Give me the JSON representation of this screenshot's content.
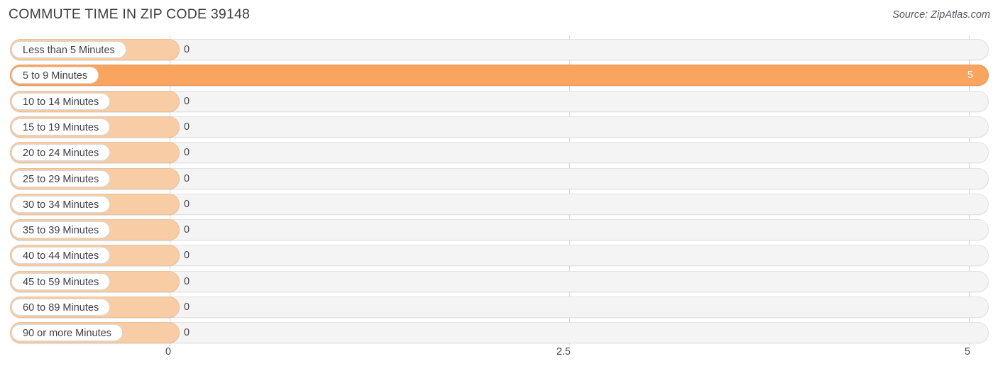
{
  "header": {
    "title": "COMMUTE TIME IN ZIP CODE 39148",
    "source": "Source: ZipAtlas.com"
  },
  "colors": {
    "bar_filled": "#f9a45f",
    "bar_zero": "#f8cda5",
    "track": "#f4f4f5",
    "gridline": "#d5d5d8",
    "text": "#45454d"
  },
  "chart_data": {
    "type": "bar",
    "orientation": "horizontal",
    "title": "COMMUTE TIME IN ZIP CODE 39148",
    "xlabel": "",
    "ylabel": "",
    "xlim": [
      0,
      5
    ],
    "grid": true,
    "legend": "none",
    "ticks": [
      {
        "label": "0",
        "value": 0
      },
      {
        "label": "2.5",
        "value": 2.5
      },
      {
        "label": "5",
        "value": 5
      }
    ],
    "categories": [
      "Less than 5 Minutes",
      "5 to 9 Minutes",
      "10 to 14 Minutes",
      "15 to 19 Minutes",
      "20 to 24 Minutes",
      "25 to 29 Minutes",
      "30 to 34 Minutes",
      "35 to 39 Minutes",
      "40 to 44 Minutes",
      "45 to 59 Minutes",
      "60 to 89 Minutes",
      "90 or more Minutes"
    ],
    "values": [
      0,
      5,
      0,
      0,
      0,
      0,
      0,
      0,
      0,
      0,
      0,
      0
    ],
    "value_labels": [
      "0",
      "5",
      "0",
      "0",
      "0",
      "0",
      "0",
      "0",
      "0",
      "0",
      "0",
      "0"
    ]
  }
}
